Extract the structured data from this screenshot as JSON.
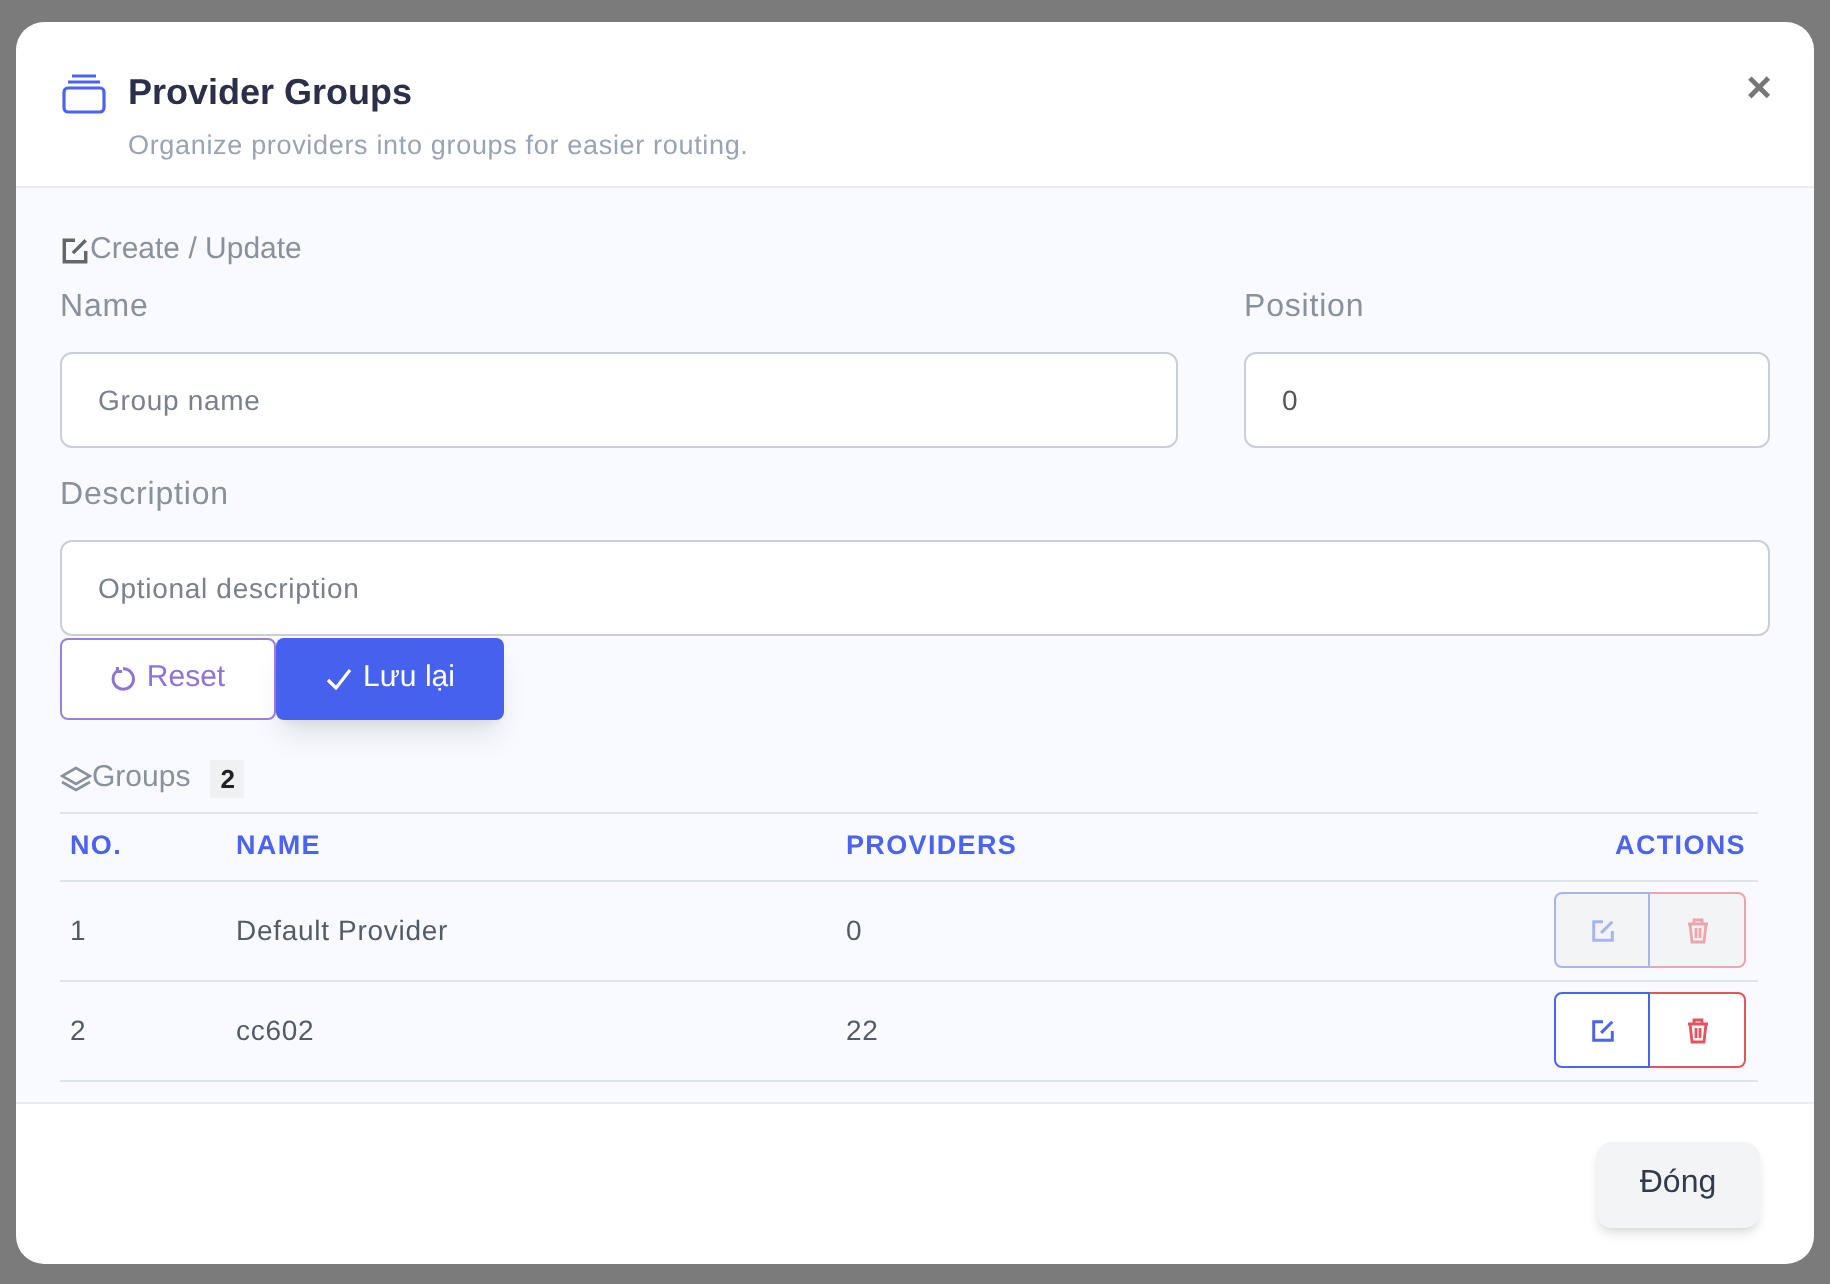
{
  "modal": {
    "title": "Provider Groups",
    "subtitle": "Organize providers into groups for easier routing.",
    "close": "×"
  },
  "form": {
    "section": "Create / Update",
    "name": {
      "label": "Name",
      "placeholder": "Group name"
    },
    "position": {
      "label": "Position",
      "value": "0"
    },
    "description": {
      "label": "Description",
      "placeholder": "Optional description"
    },
    "reset": "Reset",
    "save": "Lưu lại"
  },
  "groups": {
    "title": "Groups",
    "count": "2",
    "columns": [
      "NO.",
      "NAME",
      "PROVIDERS",
      "ACTIONS"
    ],
    "rows": [
      {
        "no": "1",
        "name": "Default Provider",
        "providers": "0",
        "disabled": true
      },
      {
        "no": "2",
        "name": "cc602",
        "providers": "22",
        "disabled": false
      }
    ]
  },
  "footer": {
    "close": "Đóng"
  }
}
